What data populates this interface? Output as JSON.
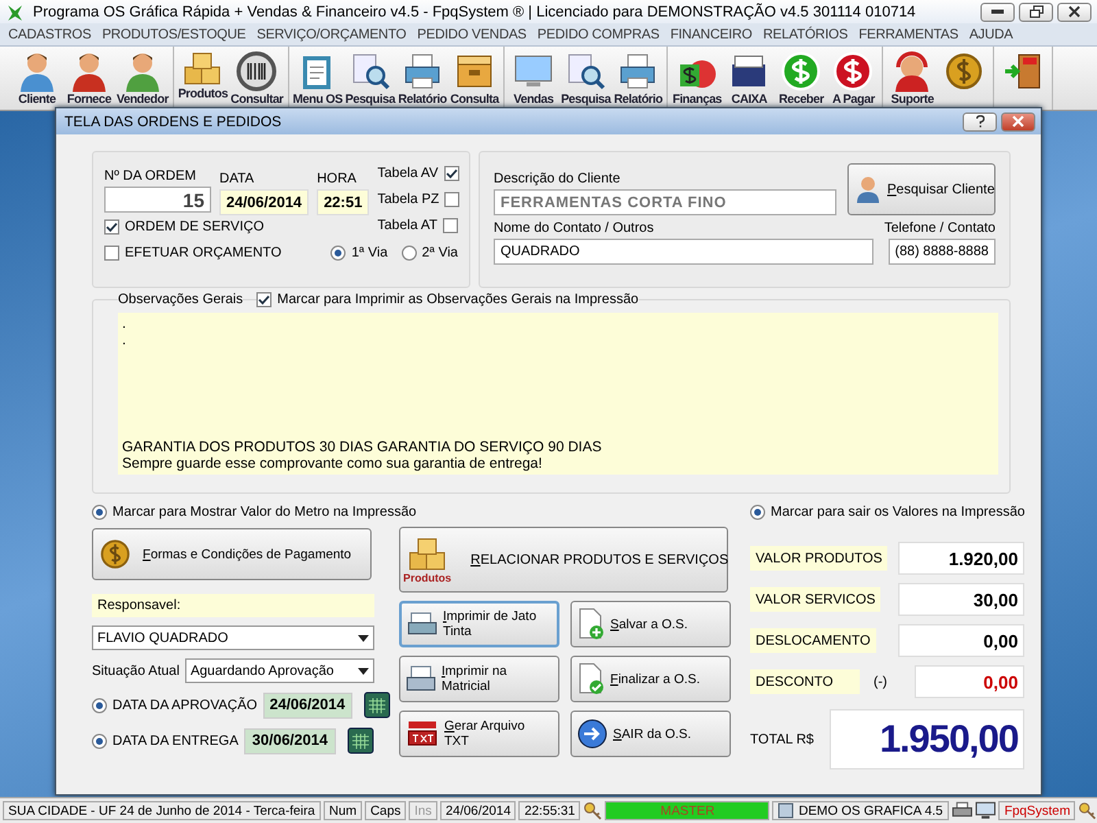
{
  "window": {
    "title": "Programa OS Gráfica Rápida + Vendas & Financeiro v4.5 - FpqSystem ® | Licenciado para  DEMONSTRAÇÃO v4.5 301114 010714"
  },
  "menu": [
    "CADASTROS",
    "PRODUTOS/ESTOQUE",
    "SERVIÇO/ORÇAMENTO",
    "PEDIDO VENDAS",
    "PEDIDO COMPRAS",
    "FINANCEIRO",
    "RELATÓRIOS",
    "FERRAMENTAS",
    "AJUDA"
  ],
  "toolbar_groups": [
    {
      "buttons": [
        {
          "label": "Cliente",
          "kind": "person-blue"
        },
        {
          "label": "Fornece",
          "kind": "person-red"
        },
        {
          "label": "Vendedor",
          "kind": "person-green"
        }
      ]
    },
    {
      "buttons": [
        {
          "label": "Produtos",
          "kind": "boxes"
        },
        {
          "label": "Consultar",
          "kind": "barcode"
        }
      ]
    },
    {
      "buttons": [
        {
          "label": "Menu OS",
          "kind": "clipboard"
        },
        {
          "label": "Pesquisa",
          "kind": "magnifier"
        },
        {
          "label": "Relatório",
          "kind": "printer"
        },
        {
          "label": "Consulta",
          "kind": "drawer"
        }
      ]
    },
    {
      "buttons": [
        {
          "label": "Vendas",
          "kind": "monitor"
        },
        {
          "label": "Pesquisa",
          "kind": "magnifier"
        },
        {
          "label": "Relatório",
          "kind": "printer"
        }
      ]
    },
    {
      "buttons": [
        {
          "label": "Finanças",
          "kind": "finance"
        },
        {
          "label": "CAIXA",
          "kind": "book"
        },
        {
          "label": "Receber",
          "kind": "dollar-green"
        },
        {
          "label": "A Pagar",
          "kind": "dollar-red"
        }
      ]
    },
    {
      "buttons": [
        {
          "label": "Suporte",
          "kind": "headset"
        },
        {
          "kind": "coin"
        }
      ]
    },
    {
      "buttons": [
        {
          "kind": "exit"
        }
      ]
    }
  ],
  "dialog": {
    "title": "TELA DAS ORDENS E PEDIDOS"
  },
  "order": {
    "number_label": "Nº DA ORDEM",
    "number": "15",
    "date_label": "DATA",
    "date": "24/06/2014",
    "time_label": "HORA",
    "time": "22:51"
  },
  "tables": [
    {
      "label": "Tabela AV",
      "checked": true
    },
    {
      "label": "Tabela PZ",
      "checked": false
    },
    {
      "label": "Tabela AT",
      "checked": false
    }
  ],
  "order_types": [
    {
      "label": "ORDEM DE SERVIÇO",
      "checked": true
    },
    {
      "label": "EFETUAR ORÇAMENTO",
      "checked": false
    }
  ],
  "copies": [
    {
      "label": "1ª Via",
      "selected": true
    },
    {
      "label": "2ª Via",
      "selected": false
    }
  ],
  "client": {
    "description_label": "Descrição do Cliente",
    "description": "FERRAMENTAS CORTA FINO",
    "search_button": "Pesquisar  Cliente",
    "contact_label": "Nome do Contato / Outros",
    "contact": "QUADRADO",
    "phone_label": "Telefone / Contato",
    "phone": "(88) 8888-8888"
  },
  "observations": {
    "label": "Observações Gerais",
    "print_option": {
      "label": "Marcar para Imprimir as Observações Gerais na Impressão",
      "checked": true
    },
    "top_lines": [
      ".",
      "."
    ],
    "bottom_lines": [
      "GARANTIA DOS PRODUTOS 30 DIAS GARANTIA DO SERVIÇO 90 DIAS",
      "Sempre guarde esse comprovante como sua garantia de entrega!"
    ]
  },
  "meter_option": {
    "label": "Marcar para Mostrar Valor do Metro na Impressão",
    "selected": true
  },
  "payment_button": "Formas e Condições de Pagamento",
  "products_button": {
    "label": "RELACIONAR PRODUTOS E SERVIÇOS",
    "icon_caption": "Produtos"
  },
  "responsible": {
    "label": "Responsavel:",
    "value": "FLAVIO QUADRADO"
  },
  "status": {
    "label": "Situação Atual",
    "value": "Aguardando Aprovação"
  },
  "dates": [
    {
      "label": "DATA DA APROVAÇÃO",
      "value": "24/06/2014",
      "selected": true
    },
    {
      "label": "DATA DA ENTREGA",
      "value": "30/06/2014",
      "selected": true
    }
  ],
  "actions": [
    {
      "label": "Imprimir de Jato Tinta",
      "kind": "inkjet",
      "focused": true
    },
    {
      "label": "Salvar a O.S.",
      "kind": "save",
      "focused": false
    },
    {
      "label": "Imprimir na Matricial",
      "kind": "matrix",
      "focused": false
    },
    {
      "label": "Finalizar a O.S.",
      "kind": "finish",
      "focused": false
    },
    {
      "label": "Gerar Arquivo TXT",
      "kind": "txt",
      "focused": false
    },
    {
      "label": "SAIR da O.S.",
      "kind": "exit",
      "focused": false
    }
  ],
  "values_option": {
    "label": "Marcar para sair os Valores na Impressão",
    "selected": true
  },
  "values": [
    {
      "label": "VALOR PRODUTOS",
      "value": "1.920,00",
      "kind": "plain"
    },
    {
      "label": "VALOR SERVICOS",
      "value": "30,00",
      "kind": "plain"
    },
    {
      "label": "DESLOCAMENTO",
      "value": "0,00",
      "kind": "plain"
    },
    {
      "label": "DESCONTO",
      "prefix": "(-)",
      "value": "0,00",
      "kind": "discount"
    }
  ],
  "total": {
    "label": "TOTAL R$",
    "value": "1.950,00"
  },
  "status_bar": [
    {
      "text": "SUA CIDADE - UF 24 de Junho de 2014 - Terca-feira",
      "kind": "text"
    },
    {
      "text": "Num",
      "kind": "text"
    },
    {
      "text": "Caps",
      "kind": "text"
    },
    {
      "text": "Ins",
      "kind": "disabled"
    },
    {
      "text": "24/06/2014",
      "kind": "text"
    },
    {
      "text": "22:55:31",
      "kind": "text"
    },
    {
      "text": "MASTER",
      "kind": "user"
    },
    {
      "text": "DEMO OS GRAFICA 4.5",
      "kind": "doc"
    },
    {
      "kind": "printer"
    },
    {
      "kind": "monitor"
    },
    {
      "text": "FpqSystem",
      "kind": "brand"
    },
    {
      "kind": "keys"
    }
  ]
}
